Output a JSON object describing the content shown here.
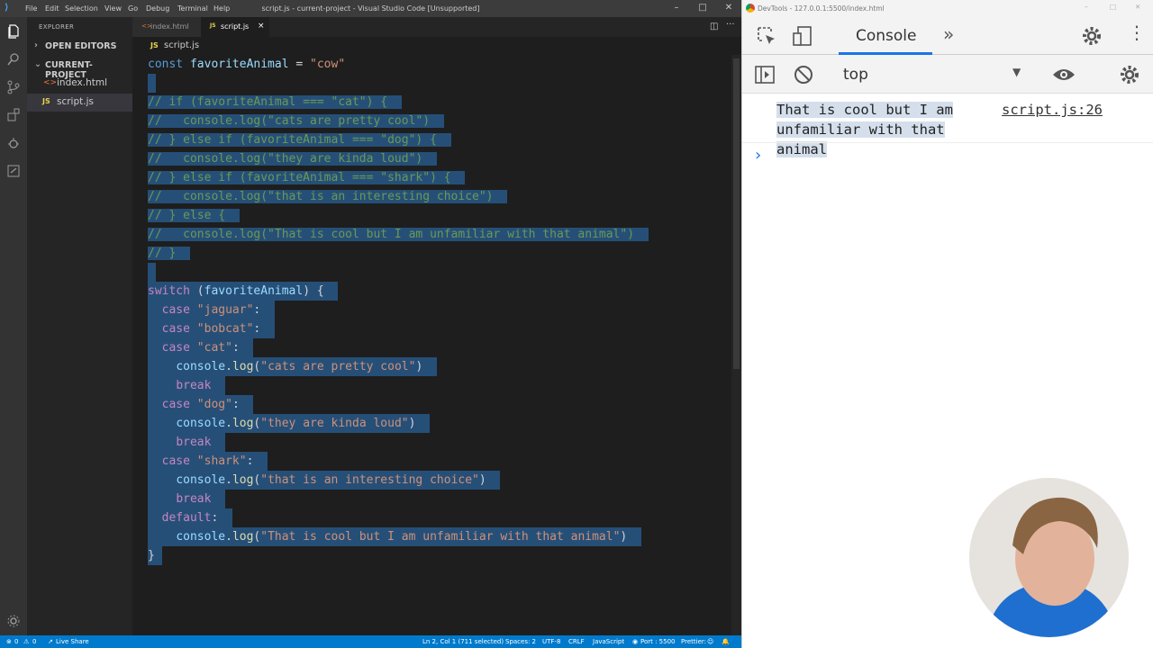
{
  "vscode": {
    "menu": [
      "File",
      "Edit",
      "Selection",
      "View",
      "Go",
      "Debug",
      "Terminal",
      "Help"
    ],
    "title": "script.js - current-project - Visual Studio Code [Unsupported]",
    "explorer_label": "EXPLORER",
    "open_editors": "OPEN EDITORS",
    "project": "CURRENT-PROJECT",
    "files": [
      "index.html",
      "script.js"
    ],
    "tabs": [
      "index.html",
      "script.js"
    ],
    "breadcrumb": "script.js",
    "status": {
      "errors": "0",
      "warnings": "0",
      "live_share": "Live Share",
      "position": "Ln 2, Col 1 (711 selected)",
      "spaces": "Spaces: 2",
      "encoding": "UTF-8",
      "eol": "CRLF",
      "language": "JavaScript",
      "port": "Port : 5500",
      "prettier": "Prettier:"
    }
  },
  "code": {
    "l1_kw": "const",
    "l1_var": "favoriteAnimal",
    "l1_eq": " = ",
    "l1_str": "\"cow\"",
    "comments": [
      "// if (favoriteAnimal === \"cat\") {",
      "//   console.log(\"cats are pretty cool\")",
      "// } else if (favoriteAnimal === \"dog\") {",
      "//   console.log(\"they are kinda loud\")",
      "// } else if (favoriteAnimal === \"shark\") {",
      "//   console.log(\"that is an interesting choice\")",
      "// } else {",
      "//   console.log(\"That is cool but I am unfamiliar with that animal\")",
      "// }"
    ],
    "switch_kw": "switch",
    "switch_arg": "favoriteAnimal",
    "case_kw": "case",
    "break_kw": "break",
    "default_kw": "default",
    "console": "console",
    "log": "log",
    "cases": [
      "\"jaguar\"",
      "\"bobcat\"",
      "\"cat\"",
      "\"dog\"",
      "\"shark\""
    ],
    "logs": [
      "\"cats are pretty cool\"",
      "\"they are kinda loud\"",
      "\"that is an interesting choice\"",
      "\"That is cool but I am unfamiliar with that animal\""
    ]
  },
  "devtools": {
    "title": "DevTools - 127.0.0.1:5500/index.html",
    "tab": "Console",
    "context": "top",
    "message": "That is cool but I am unfamiliar with that animal",
    "source": "script.js:26",
    "prompt": "›"
  }
}
